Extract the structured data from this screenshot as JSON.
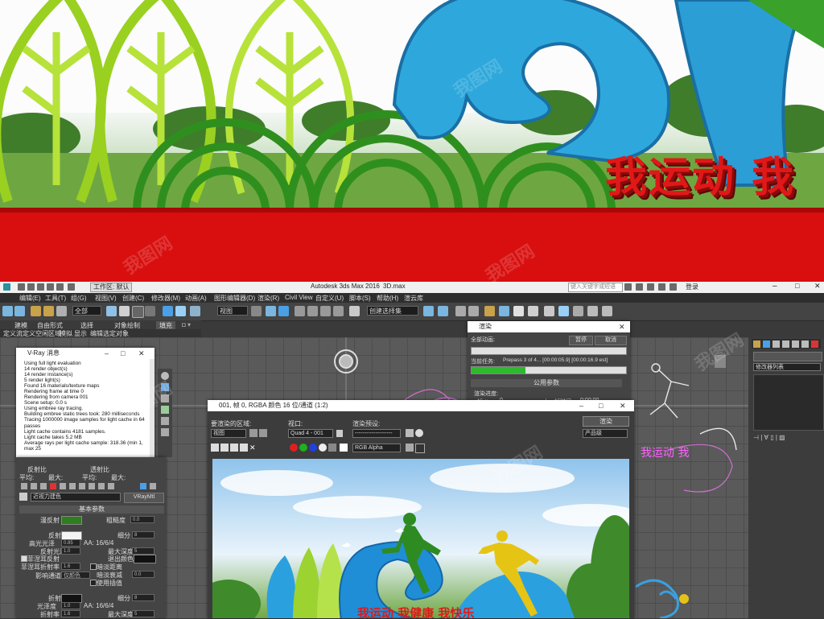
{
  "hero": {
    "slogan": "我运动 我"
  },
  "watermark": "我图网",
  "titlebar": {
    "workspace_label": "工作区: 默认",
    "app_title": "Autodesk 3ds Max 2016",
    "file_name": "3D.max",
    "search_placeholder": "键入关键字或短语",
    "login_label": "登录"
  },
  "menu": [
    "编辑(E)",
    "工具(T)",
    "组(G)",
    "视图(V)",
    "创建(C)",
    "修改器(M)",
    "动画(A)",
    "图形编辑器(D)",
    "渲染(R)",
    "Civil View",
    "自定义(U)",
    "脚本(S)",
    "帮助(H)",
    "渲云库"
  ],
  "toolbar": {
    "filter_select": "全部",
    "view_select": "视图",
    "named_selection": "创建选择集"
  },
  "ribbon": {
    "row1": [
      "建模",
      "自由形式",
      "选择",
      "对象绘制",
      "填充"
    ],
    "row2": [
      "定义流",
      "定义空闲区域",
      "模拟",
      "显示",
      "编辑选定对象"
    ]
  },
  "vray_log": {
    "title": "V-Ray 消息",
    "lines": [
      "Using full light evaluation",
      "14 render object(s)",
      "14 render instance(s)",
      "5 render light(s)",
      "Found 16 materials/texture maps",
      "Rendering frame at time 0",
      "Rendering from camera 001",
      "Scene setup: 0.0 s",
      "Using embree ray tracing.",
      "Building embree static trees took: 280 milliseconds",
      "Tracing 1000000 image samples for light cache in 64 passes",
      "Light cache contains 4181 samples.",
      "Light cache takes 5.2 MB",
      "Average rays per light cache sample: 318.36 (min 1, max 25"
    ]
  },
  "progress": {
    "title": "渲染",
    "total_anim_label": "全部动画:",
    "pause_button": "暂停",
    "cancel_button": "取消",
    "current_task_label": "当前任务:",
    "current_task_value": "Prepass 3 of 4... [00:00:05.9] [00:00:16.9 est]",
    "current_progress": 0.35,
    "common_params": "公用参数",
    "render_progress_label": "渲染进度:",
    "frame_label": "帧 #",
    "frame_value": "0",
    "last_frame_label": "上一帧时间:",
    "last_frame_value": "0:00:00"
  },
  "frame_buffer": {
    "title": "001, 帧 0, RGBA 颜色 16 位/通道 (1:2)",
    "area_label": "要渲染的区域:",
    "area_value": "视图",
    "viewport_label": "视口:",
    "viewport_value": "Quad 4 - 001",
    "preset_label": "渲染预设:",
    "preset_value": "--------------------",
    "render_button": "渲染",
    "product_value": "产品级",
    "channel_value": "RGB Alpha",
    "image_slogan": "我运动 我健康 我快乐"
  },
  "material": {
    "header_left": "反射比",
    "header_mid": "透射比",
    "sub_labels": [
      "平均:",
      "最大:",
      "平均:",
      "最大:"
    ],
    "mat_select": "近视力建色",
    "vray_mtl": "VRayMtl",
    "rollout": "基本参数",
    "diffuse": "漫反射",
    "roughness": "粗糙度",
    "roughness_value": "0.0",
    "reflect": "反射",
    "subdivs": "细分",
    "subdivs_value": "8",
    "hilight": "高光光泽",
    "hilight_value": "0.85",
    "aa_label": "AA: 16/6/4",
    "max_depth": "最大深度",
    "max_depth_value": "5",
    "refl_gloss": "反射光泽",
    "refl_gloss_value": "1.0",
    "exit_color": "退出颜色",
    "fresnel": "菲涅耳反射",
    "fresnel_ior": "菲涅耳折射率",
    "fresnel_ior_value": "1.6",
    "dim_dist": "暗淡距离",
    "dim_falloff": "暗淡衰减",
    "dim_falloff_value": "0.0",
    "affect_channels": "影响通道",
    "affect_value": "仅颜色",
    "use_interp": "使用插值",
    "refract": "折射",
    "gloss": "光泽度",
    "gloss_value": "1.0",
    "ior": "折射率",
    "ior_value": "1.6",
    "refr_subdivs": "细分",
    "refr_subdivs_value": "8",
    "refr_aa": "AA: 16/6/4",
    "refr_max_depth": "最大深度",
    "refr_max_depth_value": "5"
  },
  "cmdpanel": {
    "modifier_list": "修改器列表"
  },
  "colors": {
    "diffuse_swatch": "#2e7d1e",
    "reflect_swatch": "#f5f5f5",
    "progress_green": "#2eb82e",
    "slogan_red": "#e01818"
  }
}
